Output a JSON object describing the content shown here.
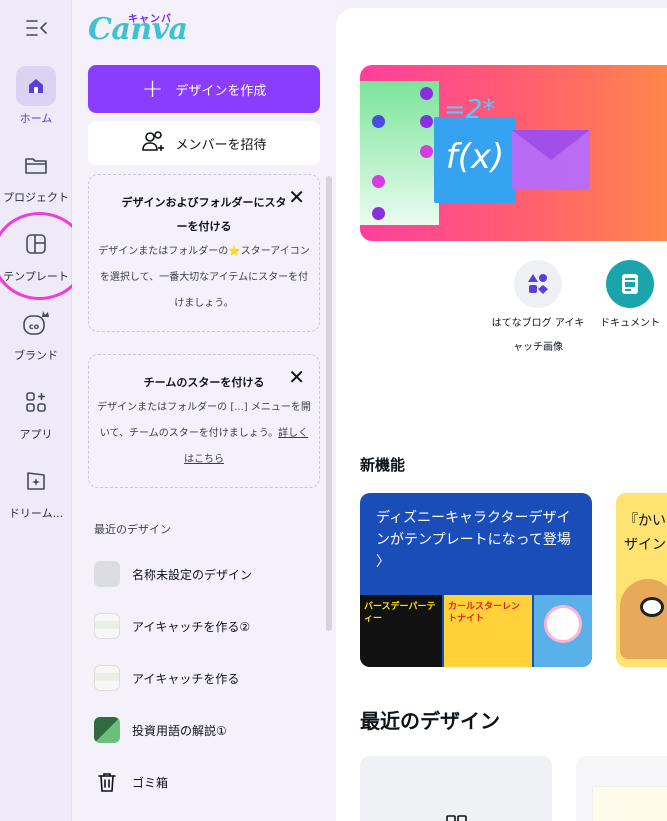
{
  "rail": {
    "toggle_icon": "collapse-menu-icon",
    "items": [
      {
        "label": "ホーム",
        "icon": "home-icon",
        "active": true
      },
      {
        "label": "プロジェクト",
        "icon": "folder-icon"
      },
      {
        "label": "テンプレート",
        "icon": "template-icon"
      },
      {
        "label": "ブランド",
        "icon": "brand-icon"
      },
      {
        "label": "アプリ",
        "icon": "apps-icon"
      },
      {
        "label": "ドリーム...",
        "icon": "dream-lab-icon"
      }
    ]
  },
  "panel": {
    "logo": "Canva",
    "logo_kana": "キャンバ",
    "create_label": "デザインを作成",
    "invite_label": "メンバーを招待",
    "tip_star": {
      "title": "デザインおよびフォルダーにスターを付ける",
      "body_before": "デザインまたはフォルダーの",
      "body_after": "スターアイコンを選択して、一番大切なアイテムにスターを付けましょう。"
    },
    "tip_team": {
      "title": "チームのスターを付ける",
      "body": "デザインまたはフォルダーの [...] メニューを開いて、チームのスターを付けましょう。",
      "link": "詳しくはこちら"
    },
    "recent_label": "最近のデザイン",
    "recent": [
      {
        "label": "名称未設定のデザイン"
      },
      {
        "label": "アイキャッチを作る②"
      },
      {
        "label": "アイキャッチを作る"
      },
      {
        "label": "投資用語の解説①"
      }
    ],
    "trash_label": "ゴミ箱"
  },
  "main": {
    "hero_formula": "f(x)",
    "hero_formula_small": "=2*",
    "quick": [
      {
        "label": "はてなブログ アイキャッチ画像",
        "icon": "shapes-icon"
      },
      {
        "label": "ドキュメント",
        "icon": "document-icon"
      }
    ],
    "new_features_title": "新機能",
    "feature_disney": "ディズニーキャラクターデザインがテンプレートになって登場",
    "feature_disney_arrow": "〉",
    "feature_partial": "『かい",
    "feature_partial2": "ザイン",
    "poster_text_1": "バースデーパーティー",
    "poster_text_2": "カールスターレントナイト",
    "recent_title": "最近のデザイン"
  },
  "colors": {
    "accent": "#8b3dff",
    "teal": "#1aa5ad",
    "highlight": "#ee3dd8"
  }
}
